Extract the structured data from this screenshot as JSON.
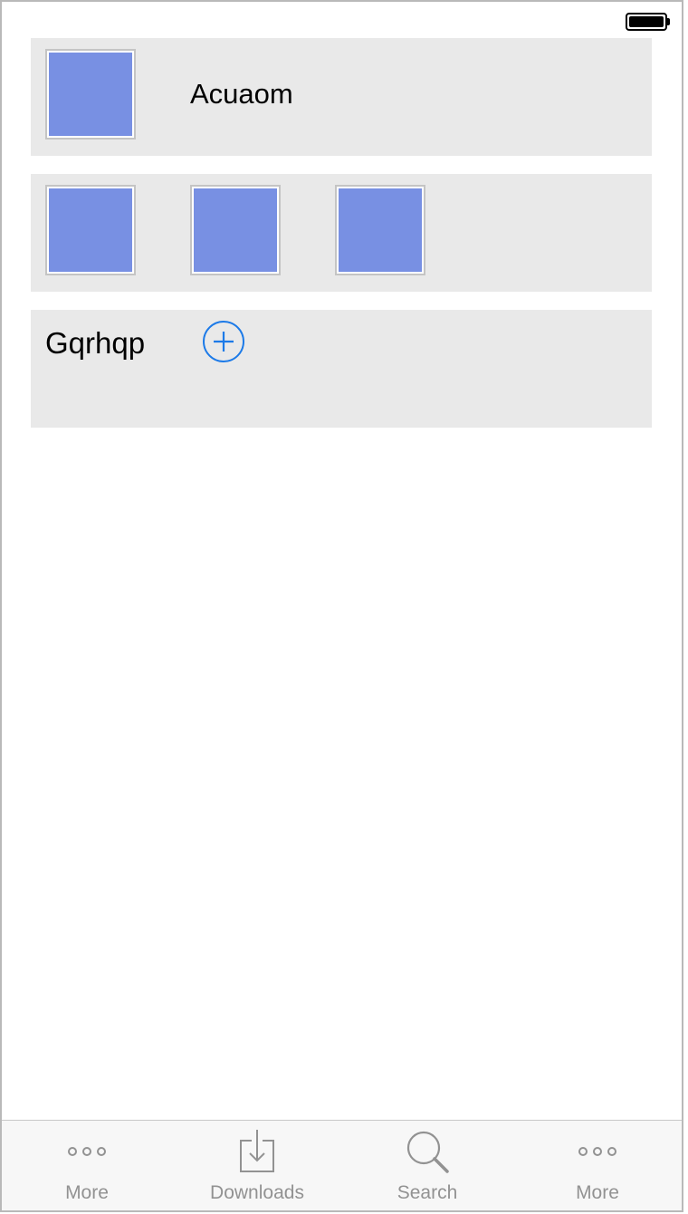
{
  "status_bar": {
    "battery_level": 1.0
  },
  "header_item": {
    "title": "Acuaom",
    "thumbnail_color": "#7890e3"
  },
  "gallery": {
    "thumbnail_count": 3,
    "thumbnail_color": "#7890e3"
  },
  "section": {
    "label": "Gqrhqp",
    "add_icon": "plus-circle-icon",
    "accent_color": "#1c7ae8"
  },
  "tab_bar": {
    "label_color": "#929292",
    "tabs": [
      {
        "label": "More",
        "icon": "more-icon"
      },
      {
        "label": "Downloads",
        "icon": "downloads-icon"
      },
      {
        "label": "Search",
        "icon": "search-icon"
      },
      {
        "label": "More",
        "icon": "more-icon"
      }
    ]
  }
}
